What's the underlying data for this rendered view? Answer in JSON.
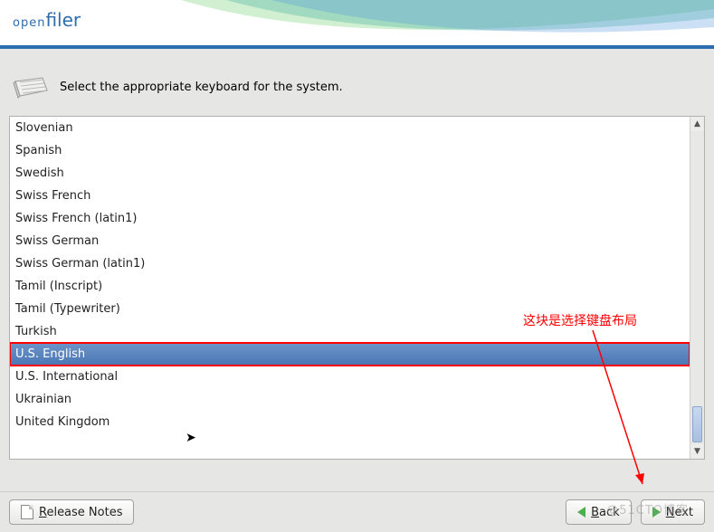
{
  "header": {
    "logo1": "open",
    "logo2": "filer"
  },
  "prompt": "Select the appropriate keyboard for the system.",
  "keyboards": [
    "Slovenian",
    "Spanish",
    "Swedish",
    "Swiss French",
    "Swiss French (latin1)",
    "Swiss German",
    "Swiss German (latin1)",
    "Tamil (Inscript)",
    "Tamil (Typewriter)",
    "Turkish",
    "U.S. English",
    "U.S. International",
    "Ukrainian",
    "United Kingdom"
  ],
  "selected_index": 10,
  "annotation": "这块是选择键盘布局",
  "buttons": {
    "release_notes_u": "R",
    "release_notes_rest": "elease Notes",
    "back_u": "B",
    "back_rest": "ack",
    "next_u": "N",
    "next_rest": "ext"
  },
  "watermark": "@51CTO博客"
}
